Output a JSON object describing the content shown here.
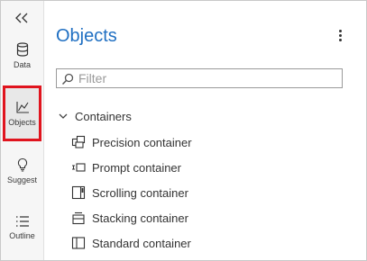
{
  "rail": {
    "items": [
      {
        "label": "Data",
        "icon": "database-icon"
      },
      {
        "label": "Objects",
        "icon": "line-chart-icon",
        "active": true
      },
      {
        "label": "Suggest",
        "icon": "lightbulb-icon"
      },
      {
        "label": "Outline",
        "icon": "list-icon"
      }
    ],
    "highlight_color": "#e0141e"
  },
  "panel": {
    "title": "Objects",
    "title_color": "#1f6fc2",
    "filter_placeholder": "Filter"
  },
  "group": {
    "label": "Containers",
    "expanded": true,
    "items": [
      {
        "label": "Precision container",
        "icon": "precision-container-icon"
      },
      {
        "label": "Prompt container",
        "icon": "prompt-container-icon"
      },
      {
        "label": "Scrolling container",
        "icon": "scrolling-container-icon"
      },
      {
        "label": "Stacking container",
        "icon": "stacking-container-icon"
      },
      {
        "label": "Standard container",
        "icon": "standard-container-icon"
      }
    ]
  }
}
